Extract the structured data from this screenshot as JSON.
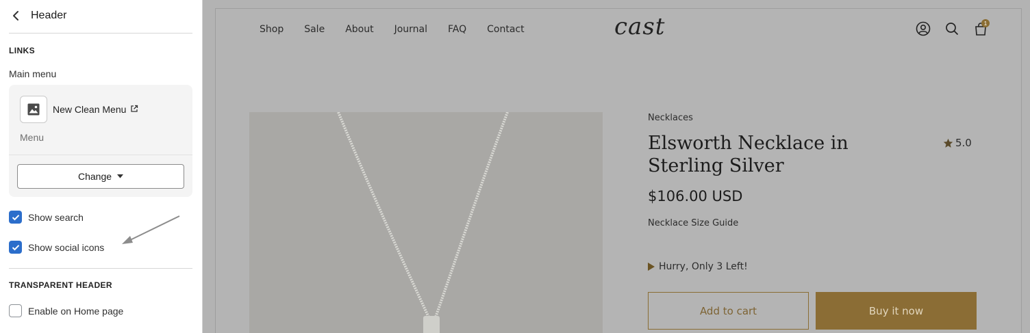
{
  "panel": {
    "title": "Header",
    "links_section": "LINKS",
    "main_menu_label": "Main menu",
    "menu_name": "New Clean Menu",
    "menu_type": "Menu",
    "change_label": "Change",
    "show_search": {
      "label": "Show search",
      "checked": true
    },
    "show_social": {
      "label": "Show social icons",
      "checked": true
    },
    "transparent_section": "TRANSPARENT HEADER",
    "enable_home": {
      "label": "Enable on Home page",
      "checked": false
    }
  },
  "store": {
    "logo": "cast",
    "nav": [
      "Shop",
      "Sale",
      "About",
      "Journal",
      "FAQ",
      "Contact"
    ],
    "cart_count": "1"
  },
  "product": {
    "category": "Necklaces",
    "title": "Elsworth Necklace in Sterling Silver",
    "rating": "5.0",
    "price": "$106.00 USD",
    "size_guide": "Necklace Size Guide",
    "stock_prefix": "Hurry, Only ",
    "stock_count": "3",
    "stock_suffix": " Left!",
    "add_to_cart": "Add to cart",
    "buy_now": "Buy it now"
  },
  "colors": {
    "accent": "#8b6d35",
    "checkbox": "#2c6ecb",
    "overlay": "#b4b4b4"
  }
}
